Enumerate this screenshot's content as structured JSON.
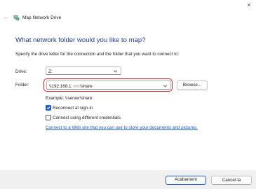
{
  "window": {
    "close_icon": "×"
  },
  "header": {
    "back_icon": "←",
    "title": "Map Network Drive"
  },
  "main": {
    "heading": "What network folder would you like to map?",
    "intro": "Specify the drive letter for the connection and the folder that you want to connect to:",
    "drive": {
      "label": "Drive:",
      "value": "Z:"
    },
    "folder": {
      "label": "Folder:",
      "value_prefix": "\\\\192.168.1.",
      "value_suffix": "\\share",
      "browse_label": "Browse..."
    },
    "example": "Example: \\\\server\\share",
    "reconnect": {
      "label": "Reconnect at sign-in",
      "checked": true
    },
    "different_credentials": {
      "label": "Connect using different credentials",
      "checked": false
    },
    "link": "Connect to a Web site that you can use to store your documents and pictures."
  },
  "footer": {
    "finish_label": "Acabament",
    "cancel_label": "Cancel·la"
  },
  "colors": {
    "accent": "#1d5fc4",
    "heading": "#1f3a8f",
    "highlight": "#d8232a"
  }
}
